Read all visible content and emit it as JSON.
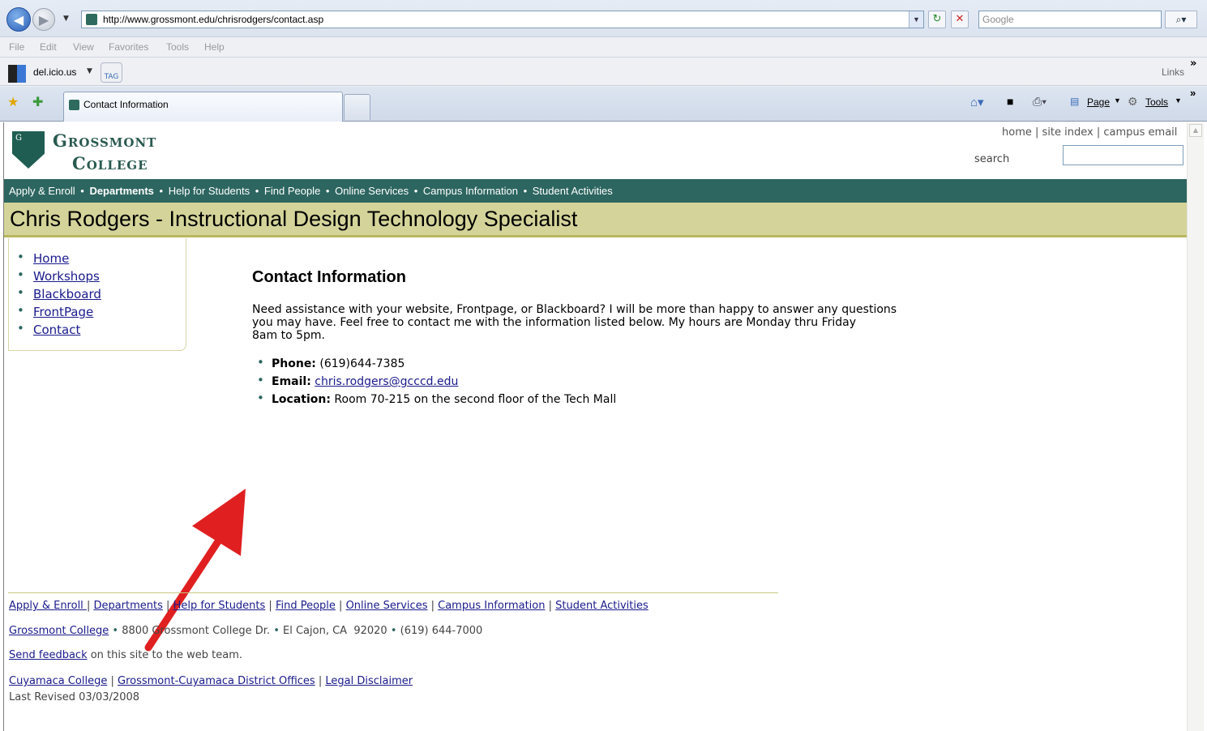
{
  "browser": {
    "url": "http://www.grossmont.edu/chrisrodgers/contact.asp",
    "search_placeholder": "Google",
    "menu": [
      "File",
      "Edit",
      "View",
      "Favorites",
      "Tools",
      "Help"
    ],
    "links_bar": {
      "delicious": "del.icio.us",
      "tag": "TAG",
      "links": "Links"
    },
    "tab_title": "Contact Information",
    "command_bar": {
      "page": "Page",
      "tools": "Tools"
    }
  },
  "header": {
    "logo_line1": "Grossmont",
    "logo_line2": "College",
    "utility_links": [
      "home",
      "site index",
      "campus email"
    ],
    "search_label": "search"
  },
  "main_nav": [
    "Apply & Enroll",
    "Departments",
    "Help for Students",
    "Find People",
    "Online Services",
    "Campus Information",
    "Student Activities"
  ],
  "page_title": "Chris Rodgers - Instructional Design Technology Specialist",
  "sidebar": [
    "Home",
    "Workshops",
    "Blackboard",
    "FrontPage",
    "Contact"
  ],
  "content": {
    "heading": "Contact Information",
    "intro_line1": "Need assistance with your website, Frontpage, or Blackboard? I will be more than happy to answer any questions",
    "intro_line2": "you may have. Feel free to contact me with the information listed below. My hours are Monday thru Friday",
    "intro_line3": "8am to 5pm.",
    "phone_label": "Phone:",
    "phone_value": "(619)644-7385",
    "email_label": "Email:",
    "email_value": "chris.rodgers@gcccd.edu",
    "location_label": "Location:",
    "location_value": "Room 70-215 on the second floor of the Tech Mall"
  },
  "footer": {
    "nav": [
      "Apply & Enroll ",
      "Departments",
      "Help for Students",
      "Find People",
      "Online Services",
      "Campus Information",
      "Student Activities"
    ],
    "college_link": "Grossmont College",
    "address": "8800 Grossmont College Dr.",
    "city": "El Cajon, CA  92020",
    "phone": "(619) 644-7000",
    "feedback_link": "Send feedback",
    "feedback_text": " on this site to the web team.",
    "cuyamaca": "Cuyamaca College",
    "district": "Grossmont-Cuyamaca District Offices",
    "legal": "Legal Disclaimer",
    "revised": "Last Revised 03/03/2008"
  },
  "colors": {
    "nav_bg": "#2d6660",
    "title_bg": "#d4d49a",
    "annotation_arrow": "#e02020"
  }
}
